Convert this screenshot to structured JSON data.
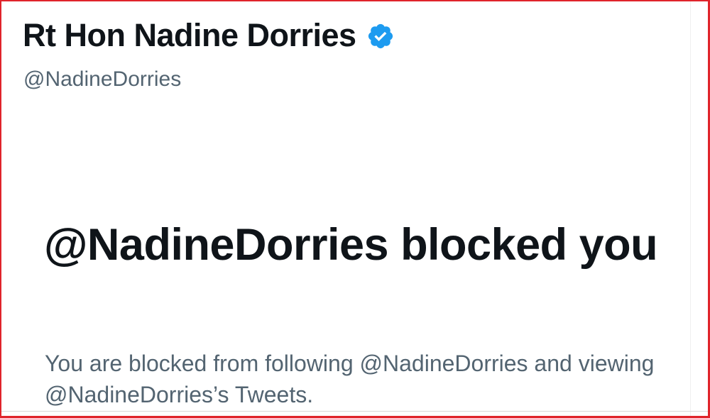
{
  "profile": {
    "display_name": "Rt Hon Nadine Dorries",
    "handle": "@NadineDorries",
    "verified_icon": "verified-badge-icon",
    "verified_color": "#1d9bf0"
  },
  "block_notice": {
    "title": "@NadineDorries blocked you",
    "description": "You are blocked from following @NadineDorries and viewing @NadineDorries’s Tweets."
  },
  "colors": {
    "frame": "#e0242b",
    "primary_text": "#0f1419",
    "secondary_text": "#536471"
  }
}
